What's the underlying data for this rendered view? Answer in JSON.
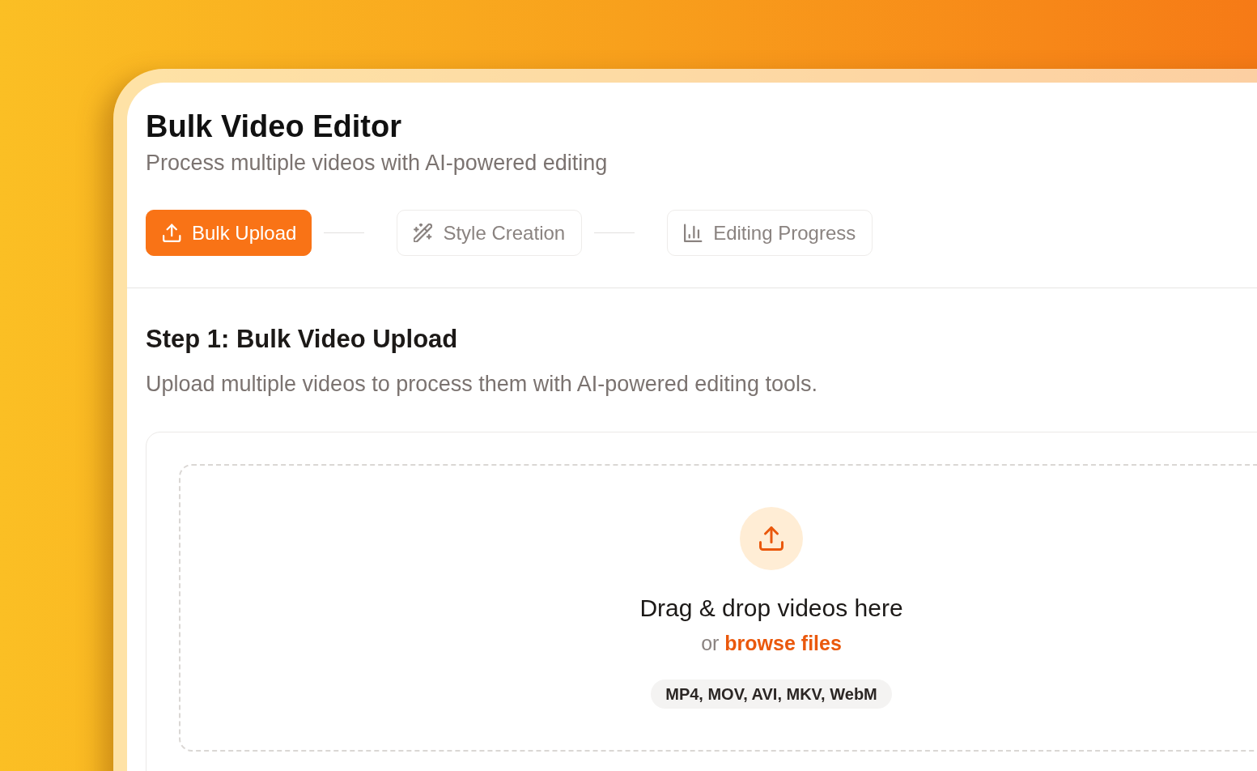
{
  "header": {
    "title": "Bulk Video Editor",
    "subtitle": "Process multiple videos with AI-powered editing"
  },
  "steps": [
    {
      "label": "Bulk Upload",
      "selected": true
    },
    {
      "label": "Style Creation",
      "selected": false
    },
    {
      "label": "Editing Progress",
      "selected": false
    }
  ],
  "section": {
    "heading": "Step 1: Bulk Video Upload",
    "description": "Upload multiple videos to process them with AI-powered editing tools."
  },
  "dropzone": {
    "prompt": "Drag & drop videos here",
    "browse_text": "or",
    "browse_link": "browse files",
    "formats": "MP4, MOV, AVI, MKV, WebM"
  }
}
